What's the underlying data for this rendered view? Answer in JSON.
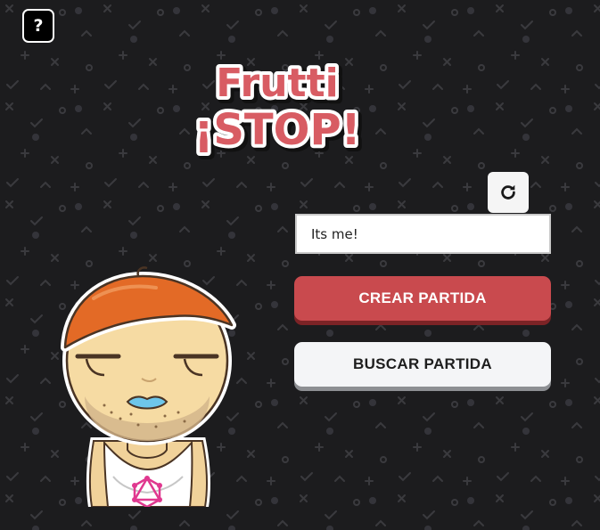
{
  "help": {
    "label": "?"
  },
  "logo": {
    "line1": "Frutti",
    "line2": "¡STOP!"
  },
  "player": {
    "name_value": "Its me!",
    "refresh_icon": "refresh-icon"
  },
  "actions": {
    "create_label": "CREAR PARTIDA",
    "search_label": "BUSCAR PARTIDA"
  },
  "colors": {
    "background": "#1c1c1e",
    "accent_red": "#c94a4e",
    "logo_red": "#d85c63"
  }
}
